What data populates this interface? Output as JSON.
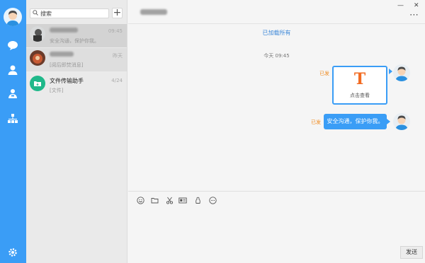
{
  "search": {
    "label": "搜索"
  },
  "conversations": [
    {
      "name": "",
      "preview": "安全沟通，保护你我。",
      "time": "09:45"
    },
    {
      "name": "",
      "preview": "[阅后即焚消息]",
      "time": "昨天"
    },
    {
      "name": "文件传输助手",
      "preview": "[文件]",
      "time": "4/24"
    }
  ],
  "chat": {
    "loaded_notice": "已加载所有",
    "timestamp": "今天 09:45",
    "messages": [
      {
        "read_status": "已发",
        "card_letter": "T",
        "card_caption": "点击查看"
      },
      {
        "read_status": "已发",
        "text": "安全沟通，保护你我。"
      }
    ],
    "send_label": "发送"
  },
  "window_controls": {
    "minimize": "—",
    "close": "✕",
    "more": "⋯"
  },
  "colors": {
    "accent": "#3a9df6",
    "read_status": "#f08a1e",
    "card_letter": "#f26b22",
    "file_helper": "#1fb88a"
  },
  "icons": {
    "rail": [
      "chat-icon",
      "contacts-icon",
      "group-icon",
      "org-icon",
      "settings-icon"
    ],
    "toolbar": [
      "emoji-icon",
      "folder-icon",
      "scissors-icon",
      "card-icon",
      "snap-icon",
      "more-icon"
    ]
  }
}
